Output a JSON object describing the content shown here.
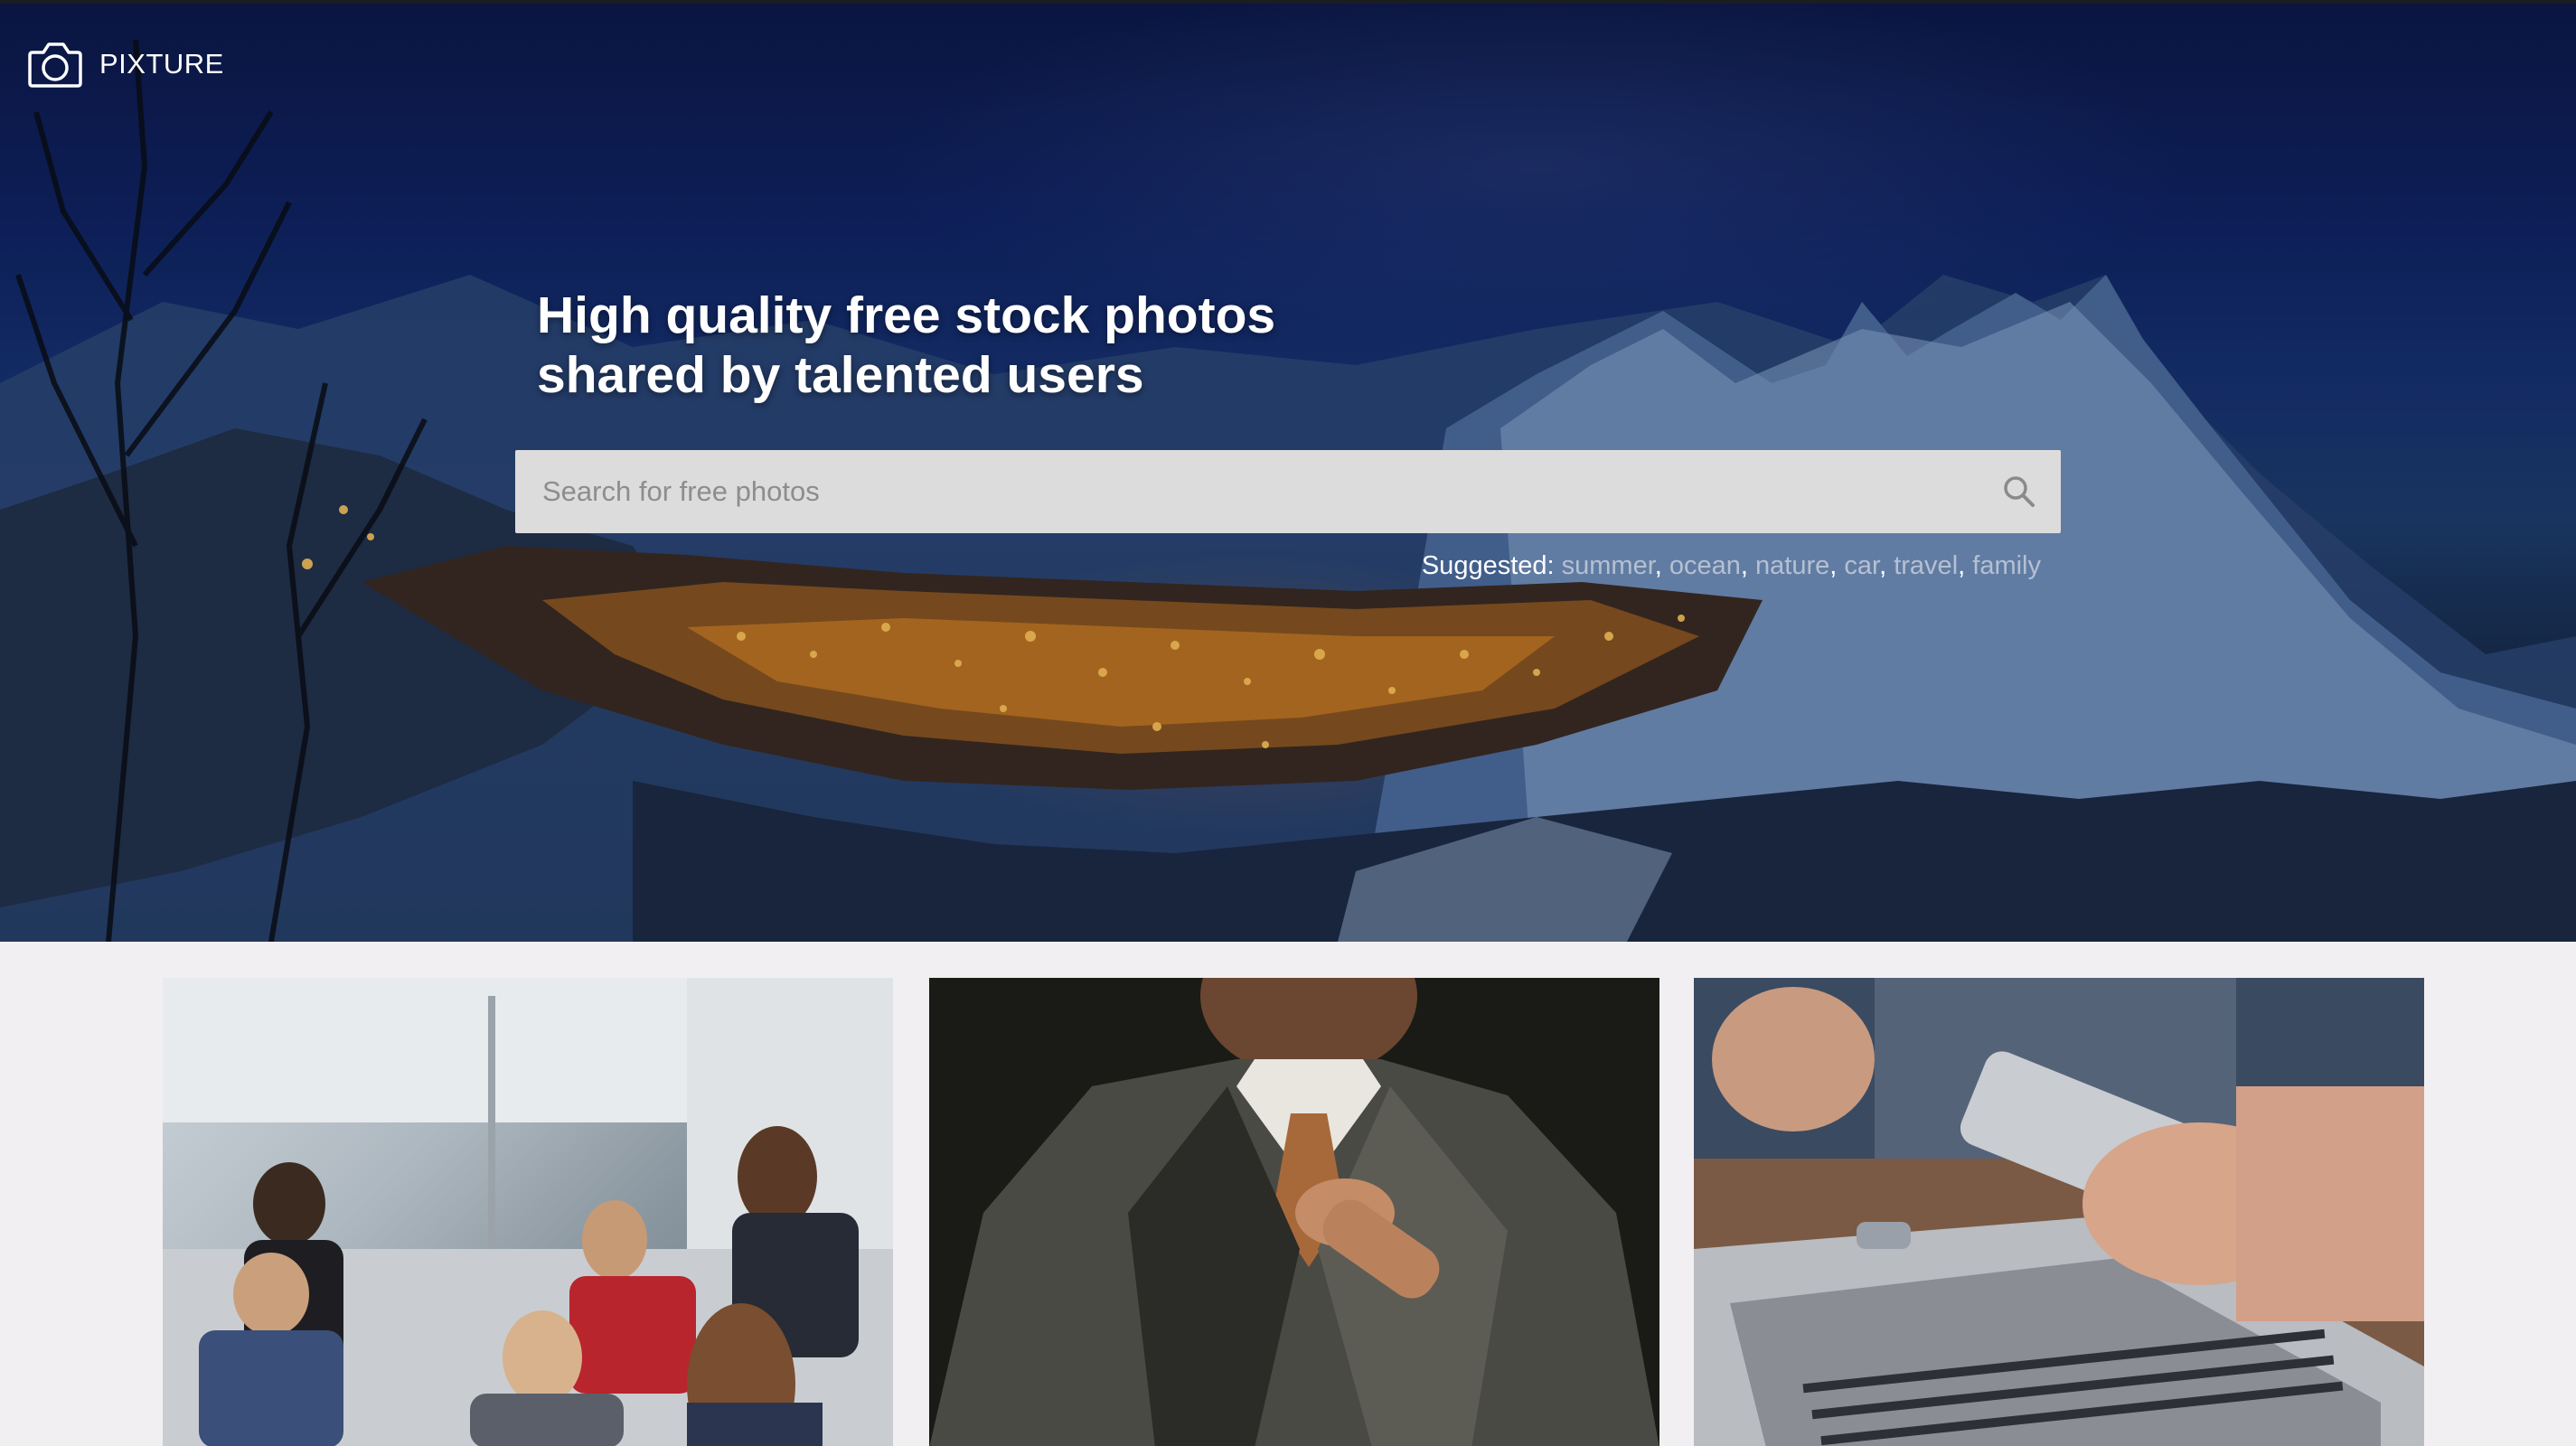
{
  "brand": {
    "name": "PIXTURE",
    "icon": "camera-icon"
  },
  "hero": {
    "headline_line1": "High quality free stock photos",
    "headline_line2": "shared by talented users",
    "search": {
      "placeholder": "Search for free photos",
      "icon": "search-icon"
    },
    "suggested": {
      "label": "Suggested:",
      "tags": [
        "summer",
        "ocean",
        "nature",
        "car",
        "travel",
        "family"
      ]
    }
  },
  "gallery": {
    "photos": [
      {
        "subject": "office-team-meeting-photo"
      },
      {
        "subject": "man-in-suit-tie-photo"
      },
      {
        "subject": "hand-holding-phone-laptop-photo"
      }
    ]
  },
  "colors": {
    "page_background": "#f2eff2",
    "search_background": "#dcdcdc",
    "hero_sky": "#0f2160"
  }
}
